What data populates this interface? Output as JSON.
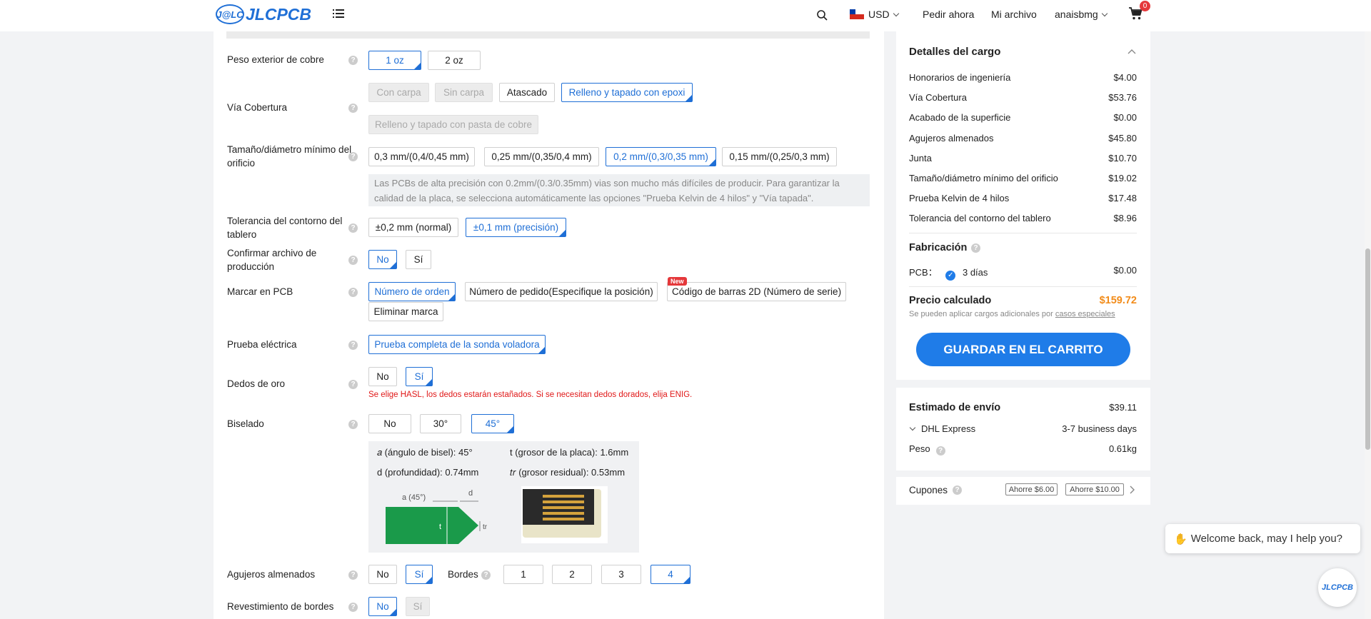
{
  "header": {
    "logo_mark": "J@LC",
    "logo_text": "JLCPCB",
    "currency": "USD",
    "nav_order_now": "Pedir ahora",
    "nav_my_file": "Mi archivo",
    "username": "anaisbmg",
    "cart_count": "0"
  },
  "form": {
    "copper": {
      "label": "Peso exterior de cobre",
      "options": [
        "1 oz",
        "2 oz"
      ],
      "selected": "1 oz"
    },
    "via": {
      "label": "Vía Cobertura",
      "options": [
        "Con carpa",
        "Sin carpa",
        "Atascado",
        "Relleno y tapado con epoxi",
        "Relleno y tapado con pasta de cobre"
      ],
      "selected": "Relleno y tapado con epoxi"
    },
    "hole": {
      "label": "Tamaño/diámetro mínimo del orificio",
      "options": [
        "0,3 mm/(0,4/0,45 mm)",
        "0,25 mm/(0,35/0,4 mm)",
        "0,2 mm/(0,3/0,35 mm)",
        "0,15 mm/(0,25/0,3 mm)"
      ],
      "selected": "0,2 mm/(0,3/0,35 mm)",
      "note": "Las PCBs de alta precisión con 0.2mm/(0.3/0.35mm) vias son mucho más difíciles de producir. Para garantizar la calidad de la placa, se selecciona automáticamente las opciones \"Prueba Kelvin de 4 hilos\" y \"Vía tapada\"."
    },
    "tolerance": {
      "label": "Tolerancia del contorno del tablero",
      "options": [
        "±0,2 mm (normal)",
        "±0,1 mm (precisión)"
      ],
      "selected": "±0,1 mm (precisión)"
    },
    "confirm": {
      "label": "Confirmar archivo de producción",
      "options": [
        "No",
        "Sí"
      ],
      "selected": "No"
    },
    "mark": {
      "label": "Marcar en PCB",
      "options": [
        "Número de orden",
        "Número de pedido(Especifique la posición)",
        "Código de barras 2D (Número de serie)",
        "Eliminar marca"
      ],
      "selected": "Número de orden",
      "new_badge": "New"
    },
    "etest": {
      "label": "Prueba eléctrica",
      "options": [
        "Prueba completa de la sonda voladora"
      ],
      "selected": "Prueba completa de la sonda voladora"
    },
    "gold": {
      "label": "Dedos de oro",
      "options": [
        "No",
        "Sí"
      ],
      "selected": "Sí",
      "warning": "Se elige HASL, los dedos estarán estañados. Si se necesitan dedos dorados, elija ENIG."
    },
    "bevel": {
      "label": "Biselado",
      "options": [
        "No",
        "30°",
        "45°"
      ],
      "selected": "45°",
      "angle": "𝑎 (ángulo de bisel): 45°",
      "thickness": "t (grosor de la placa): 1.6mm",
      "depth": "d (profundidad): 0.74mm",
      "residual": "𝑡𝑟 (grosor residual): 0.53mm",
      "diagram_a": "a (45°)",
      "diagram_d": "d",
      "diagram_t": "t",
      "diagram_tr": "tr"
    },
    "castellated": {
      "label": "Agujeros almenados",
      "options": [
        "No",
        "Sí"
      ],
      "selected": "Sí",
      "edges_label": "Bordes",
      "edges": [
        "1",
        "2",
        "3",
        "4"
      ],
      "edges_selected": "4"
    },
    "edge_plating": {
      "label": "Revestimiento de bordes",
      "options": [
        "No",
        "Sí"
      ],
      "selected": "No"
    }
  },
  "charges": {
    "title": "Detalles del cargo",
    "items": [
      {
        "name": "Honorarios de ingeniería",
        "price": "$4.00"
      },
      {
        "name": "Vía Cobertura",
        "price": "$53.76"
      },
      {
        "name": "Acabado de la superficie",
        "price": "$0.00"
      },
      {
        "name": "Agujeros almenados",
        "price": "$45.80"
      },
      {
        "name": "Junta",
        "price": "$10.70"
      },
      {
        "name": "Tamaño/diámetro mínimo del orificio",
        "price": "$19.02"
      },
      {
        "name": "Prueba Kelvin de 4 hilos",
        "price": "$17.48"
      },
      {
        "name": "Tolerancia del contorno del tablero",
        "price": "$8.96"
      }
    ],
    "fab_title": "Fabricación",
    "fab_label": "PCB：",
    "fab_days": "3 días",
    "fab_price": "$0.00",
    "calc_label": "Precio calculado",
    "calc_price": "$159.72",
    "extra_note": "Se pueden aplicar cargos adicionales por",
    "extra_link": "casos especiales",
    "save_button": "GUARDAR EN EL CARRITO"
  },
  "shipping": {
    "title": "Estimado de envío",
    "price": "$39.11",
    "carrier": "DHL Express",
    "eta": "3-7 business days",
    "weight_label": "Peso",
    "weight": "0.61kg"
  },
  "coupons": {
    "label": "Cupones",
    "items": [
      "Ahorre $6.00",
      "Ahorre $10.00"
    ]
  },
  "chat": {
    "message": "Welcome back, may I help you?",
    "avatar_text": "JLCPCB"
  },
  "colors": {
    "accent": "#1f6fd6",
    "price": "#f28c1a",
    "warning": "#e01818"
  }
}
